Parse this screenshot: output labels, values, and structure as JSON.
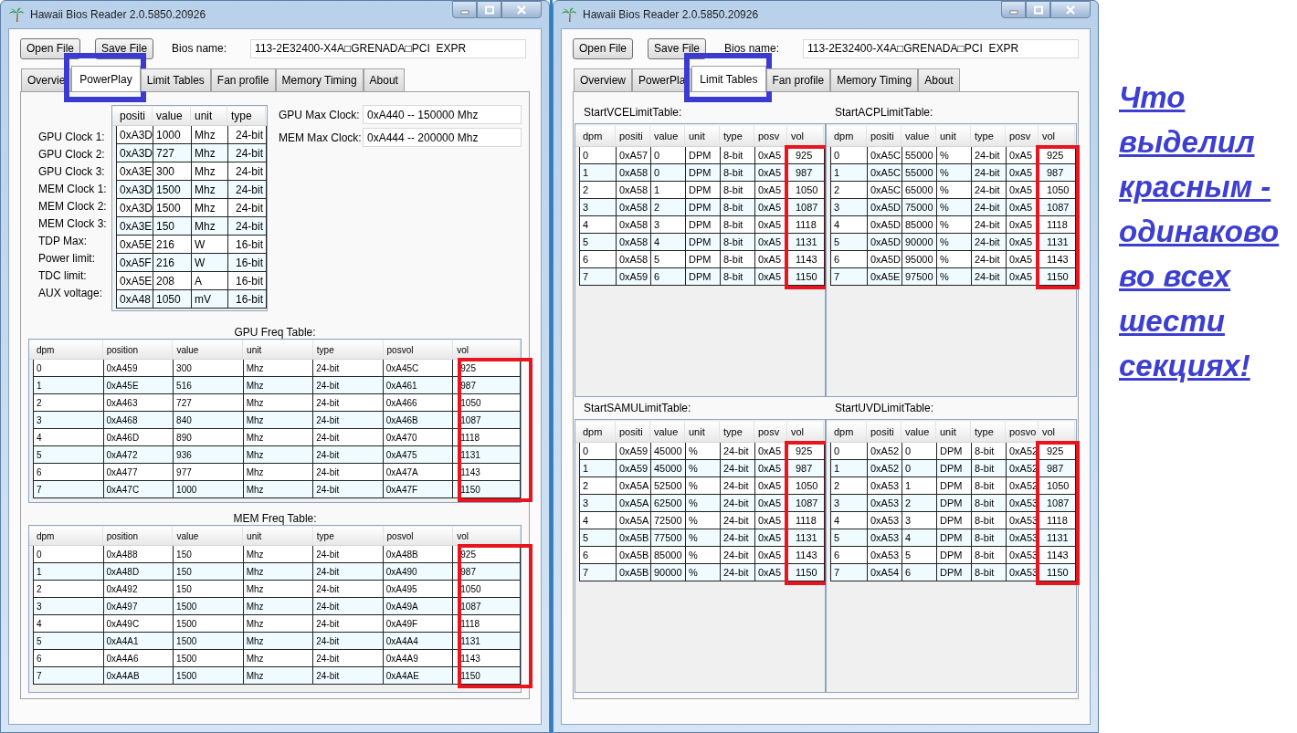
{
  "windows": [
    {
      "title": "Hawaii Bios Reader 2.0.5850.20926",
      "kind": "powerplay",
      "buttons": [
        "Open File",
        "Save File"
      ],
      "bios_name": {
        "label": "Bios name:",
        "value": "113-2E32400-X4A□GRENADA□PCI  EXPR"
      },
      "tabs": [
        {
          "label": "Overvie",
          "selected": false,
          "highlighted": false
        },
        {
          "label": "PowerPlay",
          "selected": true,
          "highlighted": true
        },
        {
          "label": "Limit Tables",
          "selected": false,
          "highlighted": false
        },
        {
          "label": "Fan profile",
          "selected": false,
          "highlighted": false
        },
        {
          "label": "Memory Timing",
          "selected": false,
          "highlighted": false
        },
        {
          "label": "About",
          "selected": false,
          "highlighted": false
        }
      ],
      "clock_table": {
        "labels": [
          "GPU Clock 1:",
          "GPU Clock 2:",
          "GPU Clock 3:",
          "MEM Clock 1:",
          "MEM Clock 2:",
          "MEM Clock 3:",
          "TDP Max:",
          "Power limit:",
          "TDC limit:",
          "AUX voltage:"
        ],
        "columns": [
          "positi",
          "value",
          "unit",
          "type"
        ],
        "rows": [
          [
            "0xA3D",
            "1000",
            "Mhz",
            "24-bit"
          ],
          [
            "0xA3D",
            "727",
            "Mhz",
            "24-bit"
          ],
          [
            "0xA3E",
            "300",
            "Mhz",
            "24-bit"
          ],
          [
            "0xA3D",
            "1500",
            "Mhz",
            "24-bit"
          ],
          [
            "0xA3D",
            "1500",
            "Mhz",
            "24-bit"
          ],
          [
            "0xA3E",
            "150",
            "Mhz",
            "24-bit"
          ],
          [
            "0xA5E",
            "216",
            "W",
            "16-bit"
          ],
          [
            "0xA5F",
            "216",
            "W",
            "16-bit"
          ],
          [
            "0xA5E",
            "208",
            "A",
            "16-bit"
          ],
          [
            "0xA48",
            "1050",
            "mV",
            "16-bit"
          ]
        ]
      },
      "max_clocks": [
        {
          "label": "GPU Max Clock:",
          "value": "0xA440 -- 150000 Mhz"
        },
        {
          "label": "MEM Max Clock:",
          "value": "0xA444 -- 200000 Mhz"
        }
      ],
      "tables": [
        {
          "title": "GPU Freq Table:",
          "highlighted": true,
          "columns": [
            "dpm",
            "position",
            "value",
            "unit",
            "type",
            "posvol",
            "vol"
          ],
          "rows": [
            [
              "0",
              "0xA459",
              "300",
              "Mhz",
              "24-bit",
              "0xA45C",
              "925"
            ],
            [
              "1",
              "0xA45E",
              "516",
              "Mhz",
              "24-bit",
              "0xA461",
              "987"
            ],
            [
              "2",
              "0xA463",
              "727",
              "Mhz",
              "24-bit",
              "0xA466",
              "1050"
            ],
            [
              "3",
              "0xA468",
              "840",
              "Mhz",
              "24-bit",
              "0xA46B",
              "1087"
            ],
            [
              "4",
              "0xA46D",
              "890",
              "Mhz",
              "24-bit",
              "0xA470",
              "1118"
            ],
            [
              "5",
              "0xA472",
              "936",
              "Mhz",
              "24-bit",
              "0xA475",
              "1131"
            ],
            [
              "6",
              "0xA477",
              "977",
              "Mhz",
              "24-bit",
              "0xA47A",
              "1143"
            ],
            [
              "7",
              "0xA47C",
              "1000",
              "Mhz",
              "24-bit",
              "0xA47F",
              "1150"
            ]
          ]
        },
        {
          "title": "MEM Freq Table:",
          "highlighted": true,
          "columns": [
            "dpm",
            "position",
            "value",
            "unit",
            "type",
            "posvol",
            "vol"
          ],
          "rows": [
            [
              "0",
              "0xA488",
              "150",
              "Mhz",
              "24-bit",
              "0xA48B",
              "925"
            ],
            [
              "1",
              "0xA48D",
              "150",
              "Mhz",
              "24-bit",
              "0xA490",
              "987"
            ],
            [
              "2",
              "0xA492",
              "150",
              "Mhz",
              "24-bit",
              "0xA495",
              "1050"
            ],
            [
              "3",
              "0xA497",
              "1500",
              "Mhz",
              "24-bit",
              "0xA49A",
              "1087"
            ],
            [
              "4",
              "0xA49C",
              "1500",
              "Mhz",
              "24-bit",
              "0xA49F",
              "1118"
            ],
            [
              "5",
              "0xA4A1",
              "1500",
              "Mhz",
              "24-bit",
              "0xA4A4",
              "1131"
            ],
            [
              "6",
              "0xA4A6",
              "1500",
              "Mhz",
              "24-bit",
              "0xA4A9",
              "1143"
            ],
            [
              "7",
              "0xA4AB",
              "1500",
              "Mhz",
              "24-bit",
              "0xA4AE",
              "1150"
            ]
          ]
        }
      ]
    },
    {
      "title": "Hawaii Bios Reader 2.0.5850.20926",
      "kind": "limit_tables",
      "buttons": [
        "Open File",
        "Save File"
      ],
      "bios_name": {
        "label": "Bios name:",
        "value": "113-2E32400-X4A□GRENADA□PCI  EXPR"
      },
      "tabs": [
        {
          "label": "Overview",
          "selected": false,
          "highlighted": false
        },
        {
          "label": "PowerPla",
          "selected": false,
          "highlighted": false
        },
        {
          "label": "Limit Tables",
          "selected": true,
          "highlighted": true
        },
        {
          "label": "Fan profile",
          "selected": false,
          "highlighted": false
        },
        {
          "label": "Memory Timing",
          "selected": false,
          "highlighted": false
        },
        {
          "label": "About",
          "selected": false,
          "highlighted": false
        }
      ],
      "tables": [
        {
          "title": "StartVCELimitTable:",
          "highlighted": true,
          "columns": [
            "dpm",
            "positi",
            "value",
            "unit",
            "type",
            "posv",
            "vol"
          ],
          "rows": [
            [
              "0",
              "0xA57",
              "0",
              "DPM",
              "8-bit",
              "0xA5",
              "925"
            ],
            [
              "1",
              "0xA58",
              "0",
              "DPM",
              "8-bit",
              "0xA5",
              "987"
            ],
            [
              "2",
              "0xA58",
              "1",
              "DPM",
              "8-bit",
              "0xA5",
              "1050"
            ],
            [
              "3",
              "0xA58",
              "2",
              "DPM",
              "8-bit",
              "0xA5",
              "1087"
            ],
            [
              "4",
              "0xA58",
              "3",
              "DPM",
              "8-bit",
              "0xA5",
              "1118"
            ],
            [
              "5",
              "0xA58",
              "4",
              "DPM",
              "8-bit",
              "0xA5",
              "1131"
            ],
            [
              "6",
              "0xA58",
              "5",
              "DPM",
              "8-bit",
              "0xA5",
              "1143"
            ],
            [
              "7",
              "0xA59",
              "6",
              "DPM",
              "8-bit",
              "0xA5",
              "1150"
            ]
          ]
        },
        {
          "title": "StartACPLimitTable:",
          "highlighted": true,
          "columns": [
            "dpm",
            "positi",
            "value",
            "unit",
            "type",
            "posv",
            "vol"
          ],
          "rows": [
            [
              "0",
              "0xA5C",
              "55000",
              "%",
              "24-bit",
              "0xA5",
              "925"
            ],
            [
              "1",
              "0xA5C",
              "55000",
              "%",
              "24-bit",
              "0xA5",
              "987"
            ],
            [
              "2",
              "0xA5C",
              "65000",
              "%",
              "24-bit",
              "0xA5",
              "1050"
            ],
            [
              "3",
              "0xA5D",
              "75000",
              "%",
              "24-bit",
              "0xA5",
              "1087"
            ],
            [
              "4",
              "0xA5D",
              "85000",
              "%",
              "24-bit",
              "0xA5",
              "1118"
            ],
            [
              "5",
              "0xA5D",
              "90000",
              "%",
              "24-bit",
              "0xA5",
              "1131"
            ],
            [
              "6",
              "0xA5D",
              "95000",
              "%",
              "24-bit",
              "0xA5",
              "1143"
            ],
            [
              "7",
              "0xA5E",
              "97500",
              "%",
              "24-bit",
              "0xA5",
              "1150"
            ]
          ]
        },
        {
          "title": "StartSAMULimitTable:",
          "highlighted": true,
          "columns": [
            "dpm",
            "positi",
            "value",
            "unit",
            "type",
            "posv",
            "vol"
          ],
          "rows": [
            [
              "0",
              "0xA59",
              "45000",
              "%",
              "24-bit",
              "0xA5",
              "925"
            ],
            [
              "1",
              "0xA59",
              "45000",
              "%",
              "24-bit",
              "0xA5",
              "987"
            ],
            [
              "2",
              "0xA5A",
              "52500",
              "%",
              "24-bit",
              "0xA5",
              "1050"
            ],
            [
              "3",
              "0xA5A",
              "62500",
              "%",
              "24-bit",
              "0xA5",
              "1087"
            ],
            [
              "4",
              "0xA5A",
              "72500",
              "%",
              "24-bit",
              "0xA5",
              "1118"
            ],
            [
              "5",
              "0xA5B",
              "77500",
              "%",
              "24-bit",
              "0xA5",
              "1131"
            ],
            [
              "6",
              "0xA5B",
              "85000",
              "%",
              "24-bit",
              "0xA5",
              "1143"
            ],
            [
              "7",
              "0xA5B",
              "90000",
              "%",
              "24-bit",
              "0xA5",
              "1150"
            ]
          ]
        },
        {
          "title": "StartUVDLimitTable:",
          "highlighted": true,
          "columns": [
            "dpm",
            "positi",
            "value",
            "unit",
            "type",
            "posvo",
            "vol"
          ],
          "rows": [
            [
              "0",
              "0xA52",
              "0",
              "DPM",
              "8-bit",
              "0xA52",
              "925"
            ],
            [
              "1",
              "0xA52",
              "0",
              "DPM",
              "8-bit",
              "0xA52",
              "987"
            ],
            [
              "2",
              "0xA53",
              "1",
              "DPM",
              "8-bit",
              "0xA52",
              "1050"
            ],
            [
              "3",
              "0xA53",
              "2",
              "DPM",
              "8-bit",
              "0xA53",
              "1087"
            ],
            [
              "4",
              "0xA53",
              "3",
              "DPM",
              "8-bit",
              "0xA53",
              "1118"
            ],
            [
              "5",
              "0xA53",
              "4",
              "DPM",
              "8-bit",
              "0xA53",
              "1131"
            ],
            [
              "6",
              "0xA53",
              "5",
              "DPM",
              "8-bit",
              "0xA53",
              "1143"
            ],
            [
              "7",
              "0xA54",
              "6",
              "DPM",
              "8-bit",
              "0xA53",
              "1150"
            ]
          ]
        }
      ]
    }
  ],
  "note": "Что выделил красным - одинаково во всех шести секциях!"
}
